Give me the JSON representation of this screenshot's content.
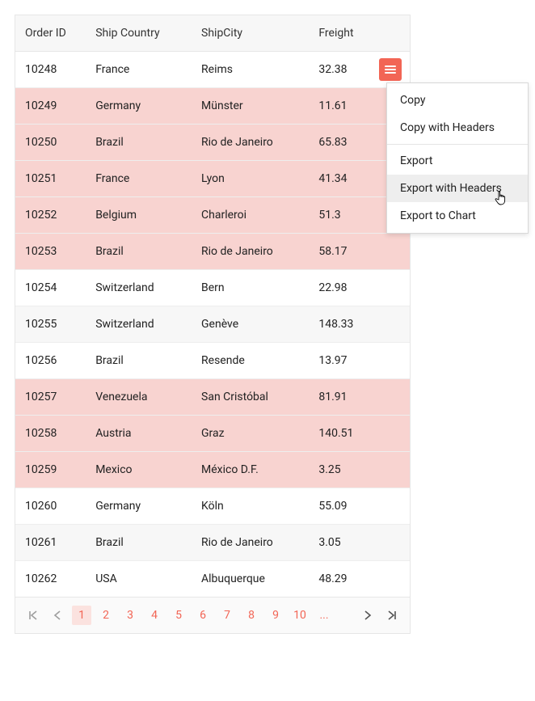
{
  "columns": [
    {
      "key": "orderId",
      "label": "Order ID"
    },
    {
      "key": "country",
      "label": "Ship Country"
    },
    {
      "key": "city",
      "label": "ShipCity"
    },
    {
      "key": "freight",
      "label": "Freight"
    }
  ],
  "rows": [
    {
      "orderId": "10248",
      "country": "France",
      "city": "Reims",
      "freight": "32.38",
      "highlight": false,
      "alt": false
    },
    {
      "orderId": "10249",
      "country": "Germany",
      "city": "Münster",
      "freight": "11.61",
      "highlight": true,
      "alt": false
    },
    {
      "orderId": "10250",
      "country": "Brazil",
      "city": "Rio de Janeiro",
      "freight": "65.83",
      "highlight": true,
      "alt": false
    },
    {
      "orderId": "10251",
      "country": "France",
      "city": "Lyon",
      "freight": "41.34",
      "highlight": true,
      "alt": false
    },
    {
      "orderId": "10252",
      "country": "Belgium",
      "city": "Charleroi",
      "freight": "51.3",
      "highlight": true,
      "alt": false
    },
    {
      "orderId": "10253",
      "country": "Brazil",
      "city": "Rio de Janeiro",
      "freight": "58.17",
      "highlight": true,
      "alt": false
    },
    {
      "orderId": "10254",
      "country": "Switzerland",
      "city": "Bern",
      "freight": "22.98",
      "highlight": false,
      "alt": false
    },
    {
      "orderId": "10255",
      "country": "Switzerland",
      "city": "Genève",
      "freight": "148.33",
      "highlight": false,
      "alt": true
    },
    {
      "orderId": "10256",
      "country": "Brazil",
      "city": "Resende",
      "freight": "13.97",
      "highlight": false,
      "alt": false
    },
    {
      "orderId": "10257",
      "country": "Venezuela",
      "city": "San Cristóbal",
      "freight": "81.91",
      "highlight": true,
      "alt": false
    },
    {
      "orderId": "10258",
      "country": "Austria",
      "city": "Graz",
      "freight": "140.51",
      "highlight": true,
      "alt": false
    },
    {
      "orderId": "10259",
      "country": "Mexico",
      "city": "México D.F.",
      "freight": "3.25",
      "highlight": true,
      "alt": false
    },
    {
      "orderId": "10260",
      "country": "Germany",
      "city": "Köln",
      "freight": "55.09",
      "highlight": false,
      "alt": false
    },
    {
      "orderId": "10261",
      "country": "Brazil",
      "city": "Rio de Janeiro",
      "freight": "3.05",
      "highlight": false,
      "alt": true
    },
    {
      "orderId": "10262",
      "country": "USA",
      "city": "Albuquerque",
      "freight": "48.29",
      "highlight": false,
      "alt": false
    }
  ],
  "menu": {
    "groups": [
      [
        {
          "label": "Copy"
        },
        {
          "label": "Copy with Headers"
        }
      ],
      [
        {
          "label": "Export"
        },
        {
          "label": "Export with Headers",
          "hover": true
        },
        {
          "label": "Export to Chart"
        }
      ]
    ]
  },
  "pager": {
    "pages": [
      "1",
      "2",
      "3",
      "4",
      "5",
      "6",
      "7",
      "8",
      "9",
      "10"
    ],
    "ellipsis": "...",
    "current": "1"
  },
  "colors": {
    "accent": "#f26555",
    "highlightRow": "#f8d3d0"
  }
}
